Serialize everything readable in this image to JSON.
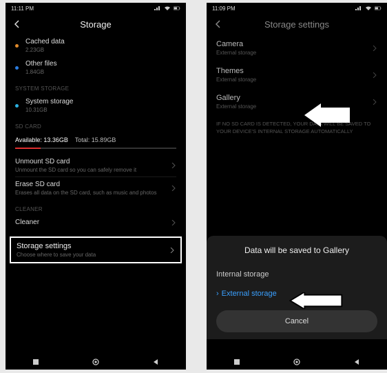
{
  "left": {
    "status_time": "11:11 PM",
    "header_title": "Storage",
    "cached": {
      "label": "Cached data",
      "value": "2.23GB",
      "dot_color": "#e08a2b"
    },
    "other": {
      "label": "Other files",
      "value": "1.84GB",
      "dot_color": "#2b7de0"
    },
    "sections": {
      "system_storage": "SYSTEM STORAGE",
      "sd_card": "SD CARD",
      "cleaner": "CLEANER"
    },
    "system_storage": {
      "label": "System storage",
      "value": "10.31GB",
      "dot_color": "#2bb0e0"
    },
    "sd_available_label": "Available:",
    "sd_available_value": "13.36GB",
    "sd_total_label": "Total:",
    "sd_total_value": "15.89GB",
    "sd_used_pct": 16,
    "unmount": {
      "label": "Unmount SD card",
      "sub": "Unmount the SD card so you can safely remove it"
    },
    "erase": {
      "label": "Erase SD card",
      "sub": "Erases all data on the SD card, such as music and photos"
    },
    "cleaner_label": "Cleaner",
    "storage_settings": {
      "label": "Storage settings",
      "sub": "Choose where to save your data"
    }
  },
  "right": {
    "status_time": "11:09 PM",
    "header_title": "Storage settings",
    "rows": [
      {
        "label": "Camera",
        "sub": "External storage"
      },
      {
        "label": "Themes",
        "sub": "External storage"
      },
      {
        "label": "Gallery",
        "sub": "External storage"
      }
    ],
    "warning": "IF NO SD CARD IS DETECTED, YOUR DATA WILL BE SAVED TO YOUR DEVICE'S INTERNAL STORAGE AUTOMATICALLY",
    "dialog": {
      "title": "Data will be saved to Gallery",
      "opt_internal": "Internal storage",
      "opt_external": "External storage",
      "cancel": "Cancel"
    }
  }
}
